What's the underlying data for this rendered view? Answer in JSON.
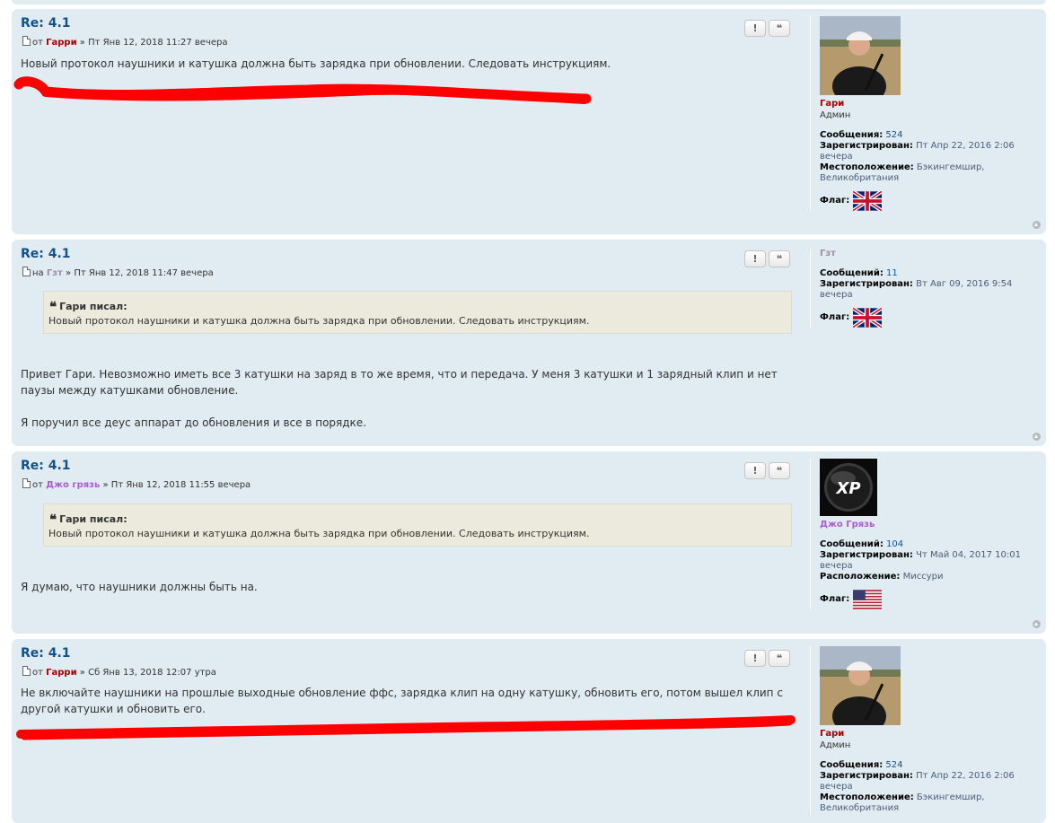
{
  "posts": [
    {
      "title": "Re: 4.1",
      "meta_prefix": "от",
      "author": "Гарри",
      "meta_sep": "»",
      "date": "Пт Янв 12, 2018 11:27 вечера",
      "quote": null,
      "body": [
        "Новый протокол наушники и катушка должна быть зарядка при обновлении. Следовать инструкциям."
      ],
      "profile": {
        "name": "Гари",
        "rank": "Админ",
        "posts_label": "Сообщения:",
        "posts_count": "524",
        "registered_label": "Зарегистрирован:",
        "registered": "Пт Апр 22, 2016 2:06 вечера",
        "location_label": "Местоположение:",
        "location": "Бэкингемшир, Великобритания",
        "flag_label": "Флаг:",
        "flag": "uk-flag-icon"
      }
    },
    {
      "title": "Re: 4.1",
      "meta_prefix": "на",
      "author": "Гзт",
      "meta_sep": "»",
      "date": "Пт Янв 12, 2018 11:47 вечера",
      "quote": {
        "cite": "Гари писал:",
        "text": "Новый протокол наушники и катушка должна быть зарядка при обновлении. Следовать инструкциям."
      },
      "body": [
        "Привет Гари. Невозможно иметь все 3 катушки на заряд в то же время, что и передача. У меня 3 катушки и 1 зарядный клип и нет паузы между катушками обновление.",
        "Я поручил все деус аппарат до обновления и все в порядке."
      ],
      "profile": {
        "name": "Гзт",
        "posts_label": "Сообщений:",
        "posts_count": "11",
        "registered_label": "Зарегистрирован:",
        "registered": "Вт Авг 09, 2016 9:54 вечера",
        "flag_label": "Флаг:",
        "flag": "uk-flag-icon"
      }
    },
    {
      "title": "Re: 4.1",
      "meta_prefix": "от",
      "author": "Джо грязь",
      "meta_sep": "»",
      "date": "Пт Янв 12, 2018 11:55 вечера",
      "quote": {
        "cite": "Гари писал:",
        "text": "Новый протокол наушники и катушка должна быть зарядка при обновлении. Следовать инструкциям."
      },
      "body": [
        "Я думаю, что наушники должны быть на."
      ],
      "profile": {
        "name": "Джо Грязь",
        "posts_label": "Сообщений:",
        "posts_count": "104",
        "registered_label": "Зарегистрирован:",
        "registered": "Чт Май 04, 2017 10:01 вечера",
        "location_label": "Расположение:",
        "location": "Миссури",
        "flag_label": "Флаг:",
        "flag": "us-flag-icon",
        "avatar_text": "XP"
      }
    },
    {
      "title": "Re: 4.1",
      "meta_prefix": "от",
      "author": "Гарри",
      "meta_sep": "»",
      "date": "Сб Янв 13, 2018 12:07 утра",
      "quote": null,
      "body": [
        "Не включайте наушники на прошлые выходные обновление ффс, зарядка клип на одну катушку, обновить его, потом вышел клип с другой катушки и обновить его."
      ],
      "profile": {
        "name": "Гари",
        "rank": "Админ",
        "posts_label": "Сообщения:",
        "posts_count": "524",
        "registered_label": "Зарегистрирован:",
        "registered": "Пт Апр 22, 2016 2:06 вечера",
        "location_label": "Местоположение:",
        "location": "Бэкингемшир, Великобритания"
      }
    }
  ],
  "buttons": {
    "report": "!",
    "quote": "❝"
  },
  "colors": {
    "post_bg": "#e1ebf2",
    "title": "#105289",
    "admin": "#aa0000",
    "highlight": "#ff0000"
  }
}
